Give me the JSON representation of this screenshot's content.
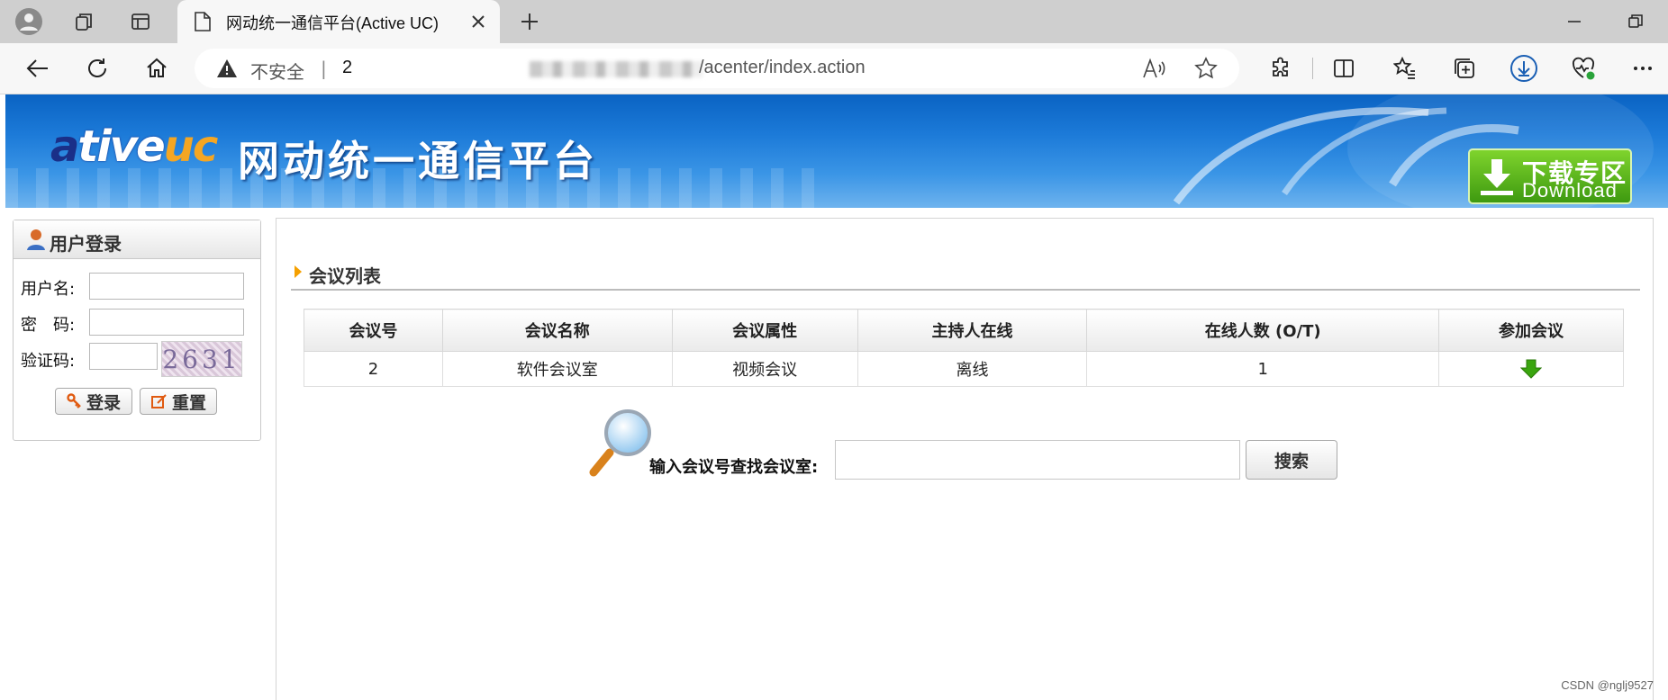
{
  "browser": {
    "tab_title": "网动统一通信平台(Active UC)",
    "security_label": "不安全",
    "url_prefix": "2",
    "url_path": "/acenter/index.action"
  },
  "banner": {
    "logo_parts": [
      "a",
      "tive",
      "uc"
    ],
    "title": "网动统一通信平台",
    "download_cn": "下载专区",
    "download_en": "Download"
  },
  "login": {
    "title": "用户登录",
    "username_label": "用户名:",
    "password_label": "密　码:",
    "captcha_label": "验证码:",
    "captcha_text": "2631",
    "login_button": "登录",
    "reset_button": "重置"
  },
  "meetings": {
    "section_title": "会议列表",
    "columns": [
      "会议号",
      "会议名称",
      "会议属性",
      "主持人在线",
      "在线人数 (O/T)",
      "参加会议"
    ],
    "rows": [
      {
        "id": "2",
        "name": "软件会议室",
        "type": "视频会议",
        "host_status": "离线",
        "online": "1"
      }
    ]
  },
  "search": {
    "label": "输入会议号查找会议室:",
    "button": "搜索"
  },
  "watermark": "CSDN @nglj9527",
  "colors": {
    "banner_blue": "#1c7ad8",
    "download_green": "#3e9a10",
    "join_arrow": "#3aa50f",
    "accent_orange": "#f5a000"
  }
}
